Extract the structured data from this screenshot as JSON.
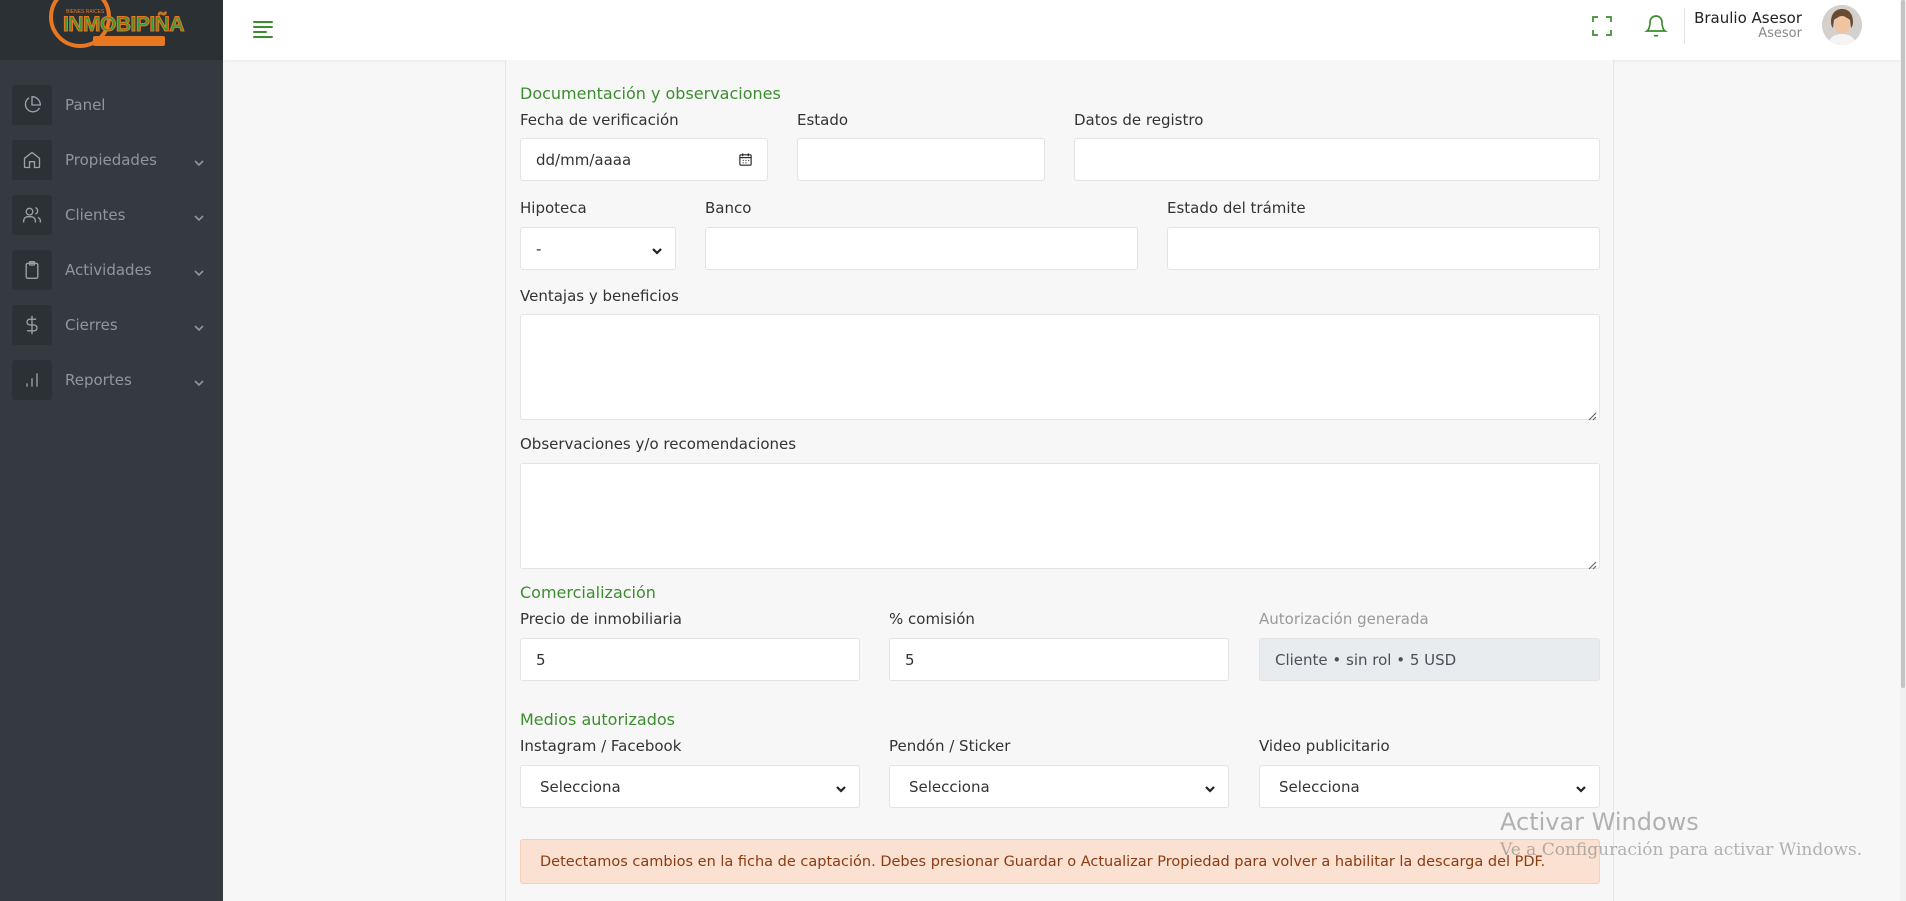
{
  "brand": {
    "logo_text": "INMOBIPIÑA",
    "logo_small": "BIENES RAICES"
  },
  "sidebar": {
    "items": [
      {
        "label": "Panel",
        "icon": "pie-chart-icon"
      },
      {
        "label": "Propiedades",
        "icon": "home-icon"
      },
      {
        "label": "Clientes",
        "icon": "users-icon"
      },
      {
        "label": "Actividades",
        "icon": "clipboard-icon"
      },
      {
        "label": "Cierres",
        "icon": "dollar-icon"
      },
      {
        "label": "Reportes",
        "icon": "bar-chart-icon"
      }
    ]
  },
  "topbar": {
    "user_name": "Braulio Asesor",
    "user_role": "Asesor",
    "icons": [
      "menu-icon",
      "fullscreen-icon",
      "bell-icon"
    ]
  },
  "form": {
    "documentacion": {
      "title": "Documentación y observaciones",
      "fecha_label": "Fecha de verificación",
      "fecha_placeholder": "dd/mm/aaaa",
      "estado_label": "Estado",
      "estado_value": "",
      "datos_label": "Datos de registro",
      "datos_value": "",
      "hipoteca_label": "Hipoteca",
      "hipoteca_value": "-",
      "banco_label": "Banco",
      "banco_value": "",
      "tramite_label": "Estado del trámite",
      "tramite_value": "",
      "ventajas_label": "Ventajas y beneficios",
      "ventajas_value": "",
      "observaciones_label": "Observaciones y/o recomendaciones",
      "observaciones_value": ""
    },
    "comercializacion": {
      "title": "Comercialización",
      "precio_label": "Precio de inmobiliaria",
      "precio_value": "5",
      "comision_label": "% comisión",
      "comision_value": "5",
      "autorizacion_label": "Autorización generada",
      "autorizacion_value": "Cliente • sin rol • 5 USD"
    },
    "medios": {
      "title": "Medios autorizados",
      "instagram_label": "Instagram / Facebook",
      "instagram_value": "Selecciona",
      "pendon_label": "Pendón / Sticker",
      "pendon_value": "Selecciona",
      "video_label": "Video publicitario",
      "video_value": "Selecciona"
    },
    "alert": "Detectamos cambios en la ficha de captación. Debes presionar Guardar o Actualizar Propiedad para volver a habilitar la descarga del PDF."
  },
  "watermark": {
    "title": "Activar Windows",
    "subtitle": "Ve a Configuración para activar Windows."
  },
  "colors": {
    "sidebar": "#343a40",
    "accent": "#3c8d2f",
    "alert_bg": "#fbe1d2",
    "alert_text": "#8a3b12"
  }
}
